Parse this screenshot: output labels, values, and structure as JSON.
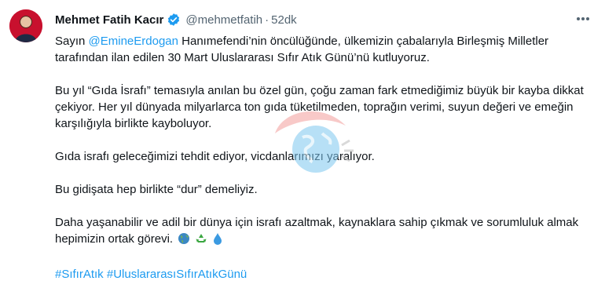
{
  "author": {
    "name": "Mehmet Fatih Kacır",
    "handle": "@mehmetfatih",
    "time": "52dk"
  },
  "tweet": {
    "p1_prefix": "Sayın ",
    "p1_mention": "@EmineErdogan",
    "p1_rest": " Hanımefendi’nin öncülüğünde, ülkemizin çabalarıyla Birleşmiş Milletler tarafından ilan edilen 30 Mart Uluslararası Sıfır Atık Günü’nü kutluyoruz.",
    "p2": "Bu yıl “Gıda İsrafı” temasıyla anılan bu özel gün, çoğu zaman fark etmediğimiz büyük bir kayba dikkat çekiyor. Her yıl dünyada milyarlarca ton gıda tüketilmeden, toprağın verimi, suyun değeri ve emeğin karşılığıyla birlikte kayboluyor.",
    "p3": "Gıda israfı geleceğimizi tehdit ediyor, vicdanlarımızı yaralıyor.",
    "p4": "Bu gidişata hep birlikte “dur” demeliyiz.",
    "p5": "Daha yaşanabilir ve adil bir dünya için israfı azaltmak, kaynaklara sahip çıkmak ve sorumluluk almak hepimizin ortak görevi.",
    "emojis": [
      "globe-emoji",
      "recycle-emoji",
      "droplet-emoji"
    ],
    "hashtag1": "#SıfırAtık",
    "hashtag2": "#UluslararasıSıfırAtıkGünü"
  },
  "colors": {
    "link": "#1d9bf0",
    "text": "#0f1419",
    "muted": "#536471",
    "verified": "#1d9bf0"
  }
}
